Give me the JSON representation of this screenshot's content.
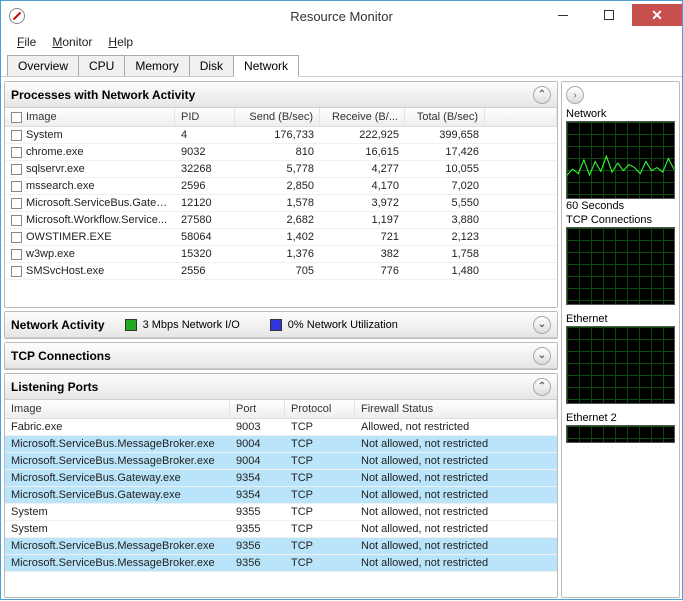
{
  "window": {
    "title": "Resource Monitor"
  },
  "menu": {
    "file": "File",
    "monitor": "Monitor",
    "help": "Help"
  },
  "tabs": [
    "Overview",
    "CPU",
    "Memory",
    "Disk",
    "Network"
  ],
  "active_tab": 4,
  "panels": {
    "processes": {
      "title": "Processes with Network Activity",
      "columns": [
        "Image",
        "PID",
        "Send (B/sec)",
        "Receive (B/...",
        "Total (B/sec)"
      ],
      "rows": [
        {
          "image": "System",
          "pid": "4",
          "send": "176,733",
          "recv": "222,925",
          "total": "399,658"
        },
        {
          "image": "chrome.exe",
          "pid": "9032",
          "send": "810",
          "recv": "16,615",
          "total": "17,426"
        },
        {
          "image": "sqlservr.exe",
          "pid": "32268",
          "send": "5,778",
          "recv": "4,277",
          "total": "10,055"
        },
        {
          "image": "mssearch.exe",
          "pid": "2596",
          "send": "2,850",
          "recv": "4,170",
          "total": "7,020"
        },
        {
          "image": "Microsoft.ServiceBus.Gatew...",
          "pid": "12120",
          "send": "1,578",
          "recv": "3,972",
          "total": "5,550"
        },
        {
          "image": "Microsoft.Workflow.Service...",
          "pid": "27580",
          "send": "2,682",
          "recv": "1,197",
          "total": "3,880"
        },
        {
          "image": "OWSTIMER.EXE",
          "pid": "58064",
          "send": "1,402",
          "recv": "721",
          "total": "2,123"
        },
        {
          "image": "w3wp.exe",
          "pid": "15320",
          "send": "1,376",
          "recv": "382",
          "total": "1,758"
        },
        {
          "image": "SMSvcHost.exe",
          "pid": "2556",
          "send": "705",
          "recv": "776",
          "total": "1,480"
        }
      ]
    },
    "activity": {
      "title": "Network Activity",
      "io_label": "3 Mbps Network I/O",
      "util_label": "0% Network Utilization"
    },
    "tcp": {
      "title": "TCP Connections"
    },
    "ports": {
      "title": "Listening Ports",
      "columns": [
        "Image",
        "Port",
        "Protocol",
        "Firewall Status"
      ],
      "rows": [
        {
          "image": "Fabric.exe",
          "port": "9003",
          "proto": "TCP",
          "fw": "Allowed, not restricted",
          "sel": false
        },
        {
          "image": "Microsoft.ServiceBus.MessageBroker.exe",
          "port": "9004",
          "proto": "TCP",
          "fw": "Not allowed, not restricted",
          "sel": true
        },
        {
          "image": "Microsoft.ServiceBus.MessageBroker.exe",
          "port": "9004",
          "proto": "TCP",
          "fw": "Not allowed, not restricted",
          "sel": true
        },
        {
          "image": "Microsoft.ServiceBus.Gateway.exe",
          "port": "9354",
          "proto": "TCP",
          "fw": "Not allowed, not restricted",
          "sel": true
        },
        {
          "image": "Microsoft.ServiceBus.Gateway.exe",
          "port": "9354",
          "proto": "TCP",
          "fw": "Not allowed, not restricted",
          "sel": true
        },
        {
          "image": "System",
          "port": "9355",
          "proto": "TCP",
          "fw": "Not allowed, not restricted",
          "sel": false
        },
        {
          "image": "System",
          "port": "9355",
          "proto": "TCP",
          "fw": "Not allowed, not restricted",
          "sel": false
        },
        {
          "image": "Microsoft.ServiceBus.MessageBroker.exe",
          "port": "9356",
          "proto": "TCP",
          "fw": "Not allowed, not restricted",
          "sel": true
        },
        {
          "image": "Microsoft.ServiceBus.MessageBroker.exe",
          "port": "9356",
          "proto": "TCP",
          "fw": "Not allowed, not restricted",
          "sel": true
        }
      ]
    }
  },
  "charts": {
    "labels": {
      "network": "Network",
      "seconds": "60 Seconds",
      "tcp": "TCP Connections",
      "eth": "Ethernet",
      "eth2": "Ethernet 2"
    }
  },
  "chart_data": [
    {
      "type": "line",
      "title": "Network",
      "x_range": [
        0,
        60
      ],
      "series": [
        {
          "name": "total",
          "values": [
            30,
            38,
            32,
            50,
            30,
            48,
            35,
            55,
            34,
            46,
            36,
            44,
            40,
            32,
            48,
            36,
            40,
            34,
            52,
            38
          ]
        }
      ],
      "ylim": [
        0,
        100
      ],
      "xlabel": "60 Seconds",
      "ylabel": ""
    },
    {
      "type": "line",
      "title": "TCP Connections",
      "x_range": [
        0,
        60
      ],
      "series": [
        {
          "name": "conns",
          "values": [
            0,
            0,
            0,
            0,
            0,
            0,
            0,
            0,
            0,
            0
          ]
        }
      ],
      "ylim": [
        0,
        100
      ]
    },
    {
      "type": "line",
      "title": "Ethernet",
      "x_range": [
        0,
        60
      ],
      "series": [
        {
          "name": "io",
          "values": [
            0,
            0,
            0,
            0,
            0,
            0,
            0,
            0,
            0,
            0
          ]
        }
      ],
      "ylim": [
        0,
        100
      ]
    },
    {
      "type": "line",
      "title": "Ethernet 2",
      "x_range": [
        0,
        60
      ],
      "series": [
        {
          "name": "io",
          "values": [
            0,
            0,
            0,
            0,
            0,
            0,
            0,
            0,
            0,
            0
          ]
        }
      ],
      "ylim": [
        0,
        100
      ]
    }
  ]
}
